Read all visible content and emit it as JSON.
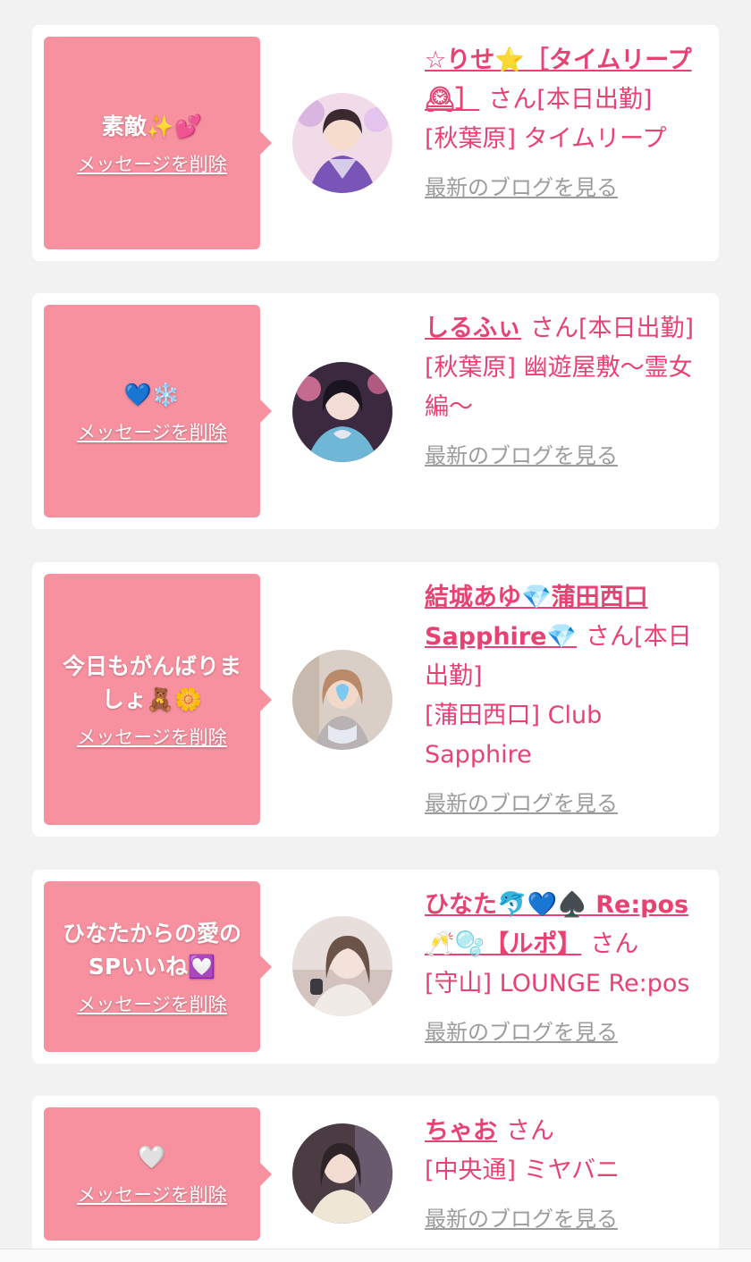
{
  "cards": [
    {
      "message": "素敵✨💕",
      "delete_label": "メッセージを削除",
      "name": "☆りせ⭐️［タイムリープ🕰］",
      "honorific": "さん",
      "status": "[本日出勤]",
      "shop": "[秋葉原] タイムリープ",
      "blog_label": "最新のブログを見る",
      "avatar_color": "#7a55b8"
    },
    {
      "message": "💙❄️",
      "delete_label": "メッセージを削除",
      "name": "しるふぃ",
      "honorific": "さん",
      "status": "[本日出勤]",
      "shop": "[秋葉原] 幽遊屋敷〜霊女編〜",
      "blog_label": "最新のブログを見る",
      "avatar_color": "#3b2a3f"
    },
    {
      "message": "今日もがんばりましょ🧸🌼",
      "delete_label": "メッセージを削除",
      "name": "結城あゆ💎蒲田西口Sapphire💎",
      "honorific": "さん",
      "status": "[本日出勤]",
      "shop": "[蒲田西口] Club Sapphire",
      "blog_label": "最新のブログを見る",
      "avatar_color": "#b9a79a"
    },
    {
      "message": "ひなたからの愛のSPいいね💟",
      "delete_label": "メッセージを削除",
      "name": "ひなた🐬💙♠️ Re:pos 🥂🫧【ルポ】",
      "honorific": "さん",
      "status": "",
      "shop": "[守山] LOUNGE Re:pos",
      "blog_label": "最新のブログを見る",
      "avatar_color": "#d8c7c2"
    },
    {
      "message": "🤍",
      "delete_label": "メッセージを削除",
      "name": "ちゃお",
      "honorific": "さん",
      "status": "",
      "shop": "[中央通] ミヤバニ",
      "blog_label": "最新のブログを見る",
      "avatar_color": "#5a4a4e"
    }
  ],
  "colors": {
    "accent": "#e84272",
    "message_bg": "#f7909f",
    "muted_link": "#9c9c9c",
    "page_bg": "#f2f2f3"
  }
}
